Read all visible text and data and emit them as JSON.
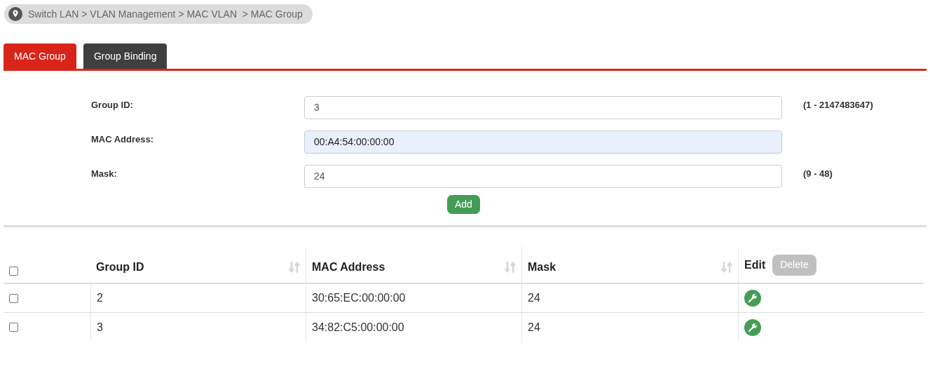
{
  "breadcrumb": "Switch LAN > VLAN Management > MAC VLAN  > MAC Group",
  "tabs": [
    {
      "label": "MAC Group",
      "selected": true
    },
    {
      "label": "Group Binding",
      "selected": false
    }
  ],
  "form": {
    "fields": [
      {
        "label": "Group ID:",
        "value": "3",
        "highlighted": false,
        "hint": "(1 - 2147483647)"
      },
      {
        "label": "MAC Address:",
        "value": "00:A4:54:00:00:00",
        "highlighted": true
      },
      {
        "label": "Mask:",
        "value": "24",
        "highlighted": false,
        "hint": "(9 - 48)"
      }
    ],
    "add_button": "Add"
  },
  "table": {
    "select_all_checked": false,
    "columns": [
      {
        "label": "Group ID",
        "sortable": true
      },
      {
        "label": "MAC Address",
        "sortable": true
      },
      {
        "label": "Mask",
        "sortable": true
      },
      {
        "label": "Edit",
        "sortable": false
      }
    ],
    "delete_button": {
      "label": "Delete",
      "disabled": true
    },
    "rows": [
      {
        "checked": false,
        "cells": [
          "2",
          "30:65:EC:00:00:00",
          "24"
        ]
      },
      {
        "checked": false,
        "cells": [
          "3",
          "34:82:C5:00:00:00",
          "24"
        ]
      }
    ]
  }
}
